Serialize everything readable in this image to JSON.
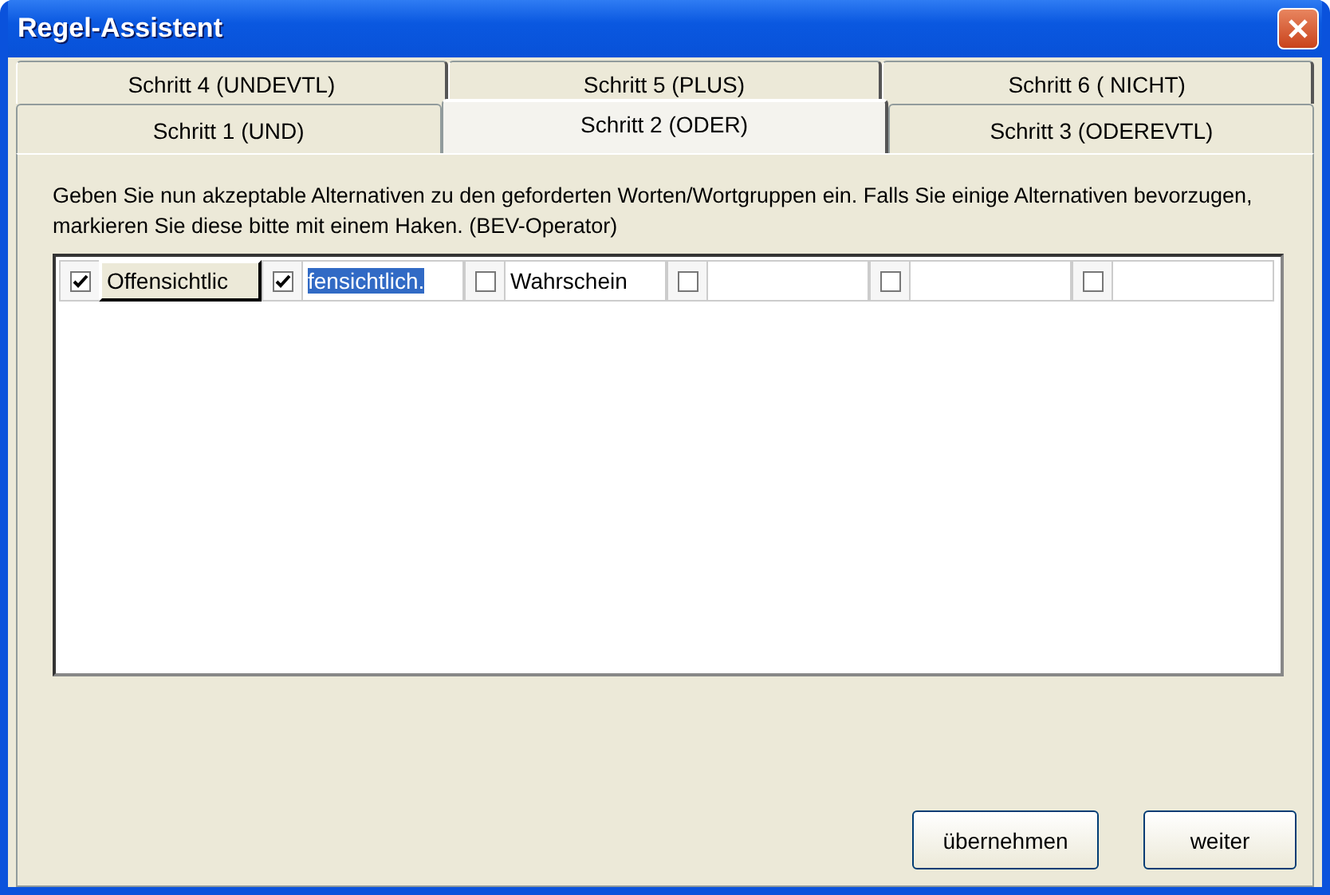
{
  "window": {
    "title": "Regel-Assistent"
  },
  "tab_rows": [
    [
      {
        "label": "Schritt 4 (UNDEVTL)",
        "selected": false
      },
      {
        "label": "Schritt 5 (PLUS)",
        "selected": false
      },
      {
        "label": "Schritt 6 ( NICHT)",
        "selected": false
      }
    ],
    [
      {
        "label": "Schritt 1 (UND)",
        "selected": false
      },
      {
        "label": "Schritt 2 (ODER)",
        "selected": true
      },
      {
        "label": "Schritt 3 (ODEREVTL)",
        "selected": false
      }
    ]
  ],
  "instructions": "Geben Sie nun akzeptable Alternativen zu den geforderten Worten/Wortgruppen ein. Falls Sie einige Alternativen bevorzugen, markieren Sie diese bitte mit einem Haken. (BEV-Operator)",
  "alternatives": [
    {
      "checked": true,
      "kind": "cell",
      "value": "Offensichtlic",
      "highlighted": false
    },
    {
      "checked": true,
      "kind": "input",
      "value": "fensichtlich.",
      "highlighted": true
    },
    {
      "checked": false,
      "kind": "input",
      "value": "Wahrschein",
      "highlighted": false
    },
    {
      "checked": false,
      "kind": "input"
    },
    {
      "checked": false,
      "kind": "input"
    },
    {
      "checked": false,
      "kind": "input"
    }
  ],
  "buttons": [
    "übernehmen",
    "weiter"
  ]
}
